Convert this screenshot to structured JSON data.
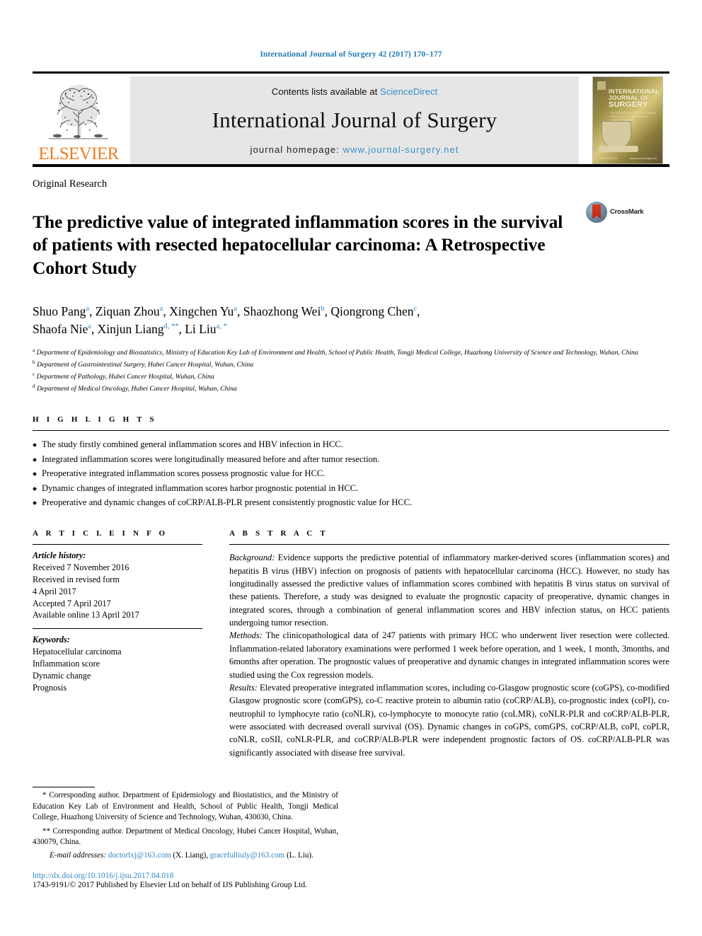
{
  "running_head": "International Journal of Surgery 42 (2017) 170–177",
  "masthead": {
    "publisher_name": "ELSEVIER",
    "contents_prefix": "Contents lists available at ",
    "sciencedirect": "ScienceDirect",
    "journal_name": "International Journal of Surgery",
    "homepage_prefix": "journal homepage: ",
    "homepage_url": "www.journal-surgery.net",
    "cover": {
      "line1": "INTERNATIONAL",
      "line2": "JOURNAL OF",
      "line3": "SURGERY",
      "subtitle": "The Official Journal of the Surgical Associates Ltd. International Journal of Surgery",
      "footer_left": "ISSN 1743-9191",
      "footer_right": "www.journal-surgery.net"
    }
  },
  "article": {
    "section_label": "Original Research",
    "title": "The predictive value of integrated inflammation scores in the survival of patients with resected hepatocellular carcinoma: A Retrospective Cohort Study",
    "crossmark_label": "CrossMark",
    "authors_line1": "Shuo Pang ᵃ, Ziquan Zhou ᵃ, Xingchen Yu ᵃ, Shaozhong Wei ᵇ, Qiongrong Chen ᶜ,",
    "authors_line2": "Shaofa Nie ᵃ, Xinjun Liang ᵈ,**, Li Liu ᵃ,*",
    "authors": [
      {
        "name": "Shuo Pang",
        "sup": "a"
      },
      {
        "name": "Ziquan Zhou",
        "sup": "a"
      },
      {
        "name": "Xingchen Yu",
        "sup": "a"
      },
      {
        "name": "Shaozhong Wei",
        "sup": "b"
      },
      {
        "name": "Qiongrong Chen",
        "sup": "c"
      },
      {
        "name": "Shaofa Nie",
        "sup": "a"
      },
      {
        "name": "Xinjun Liang",
        "sup": "d, **"
      },
      {
        "name": "Li Liu",
        "sup": "a, *"
      }
    ],
    "affiliations": [
      {
        "marker": "a",
        "text": "Department of Epidemiology and Biostatistics, Ministry of Education Key Lab of Environment and Health, School of Public Health, Tongji Medical College, Huazhong University of Science and Technology, Wuhan, China"
      },
      {
        "marker": "b",
        "text": "Department of Gastrointestinal Surgery, Hubei Cancer Hospital, Wuhan, China"
      },
      {
        "marker": "c",
        "text": "Department of Pathology, Hubei Cancer Hospital, Wuhan, China"
      },
      {
        "marker": "d",
        "text": "Department of Medical Oncology, Hubei Cancer Hospital, Wuhan, China"
      }
    ]
  },
  "highlights": {
    "heading": "H I G H L I G H T S",
    "items": [
      "The study firstly combined general inflammation scores and HBV infection in HCC.",
      "Integrated inflammation scores were longitudinally measured before and after tumor resection.",
      "Preoperative integrated inflammation scores possess prognostic value for HCC.",
      "Dynamic changes of integrated inflammation scores harbor prognostic potential in HCC.",
      "Preoperative and dynamic changes of coCRP/ALB-PLR present consistently prognostic value for HCC."
    ]
  },
  "article_info": {
    "heading": "A R T I C L E   I N F O",
    "history_label": "Article history:",
    "history": [
      "Received 7 November 2016",
      "Received in revised form",
      "4 April 2017",
      "Accepted 7 April 2017",
      "Available online 13 April 2017"
    ],
    "keywords_label": "Keywords:",
    "keywords": [
      "Hepatocellular carcinoma",
      "Inflammation score",
      "Dynamic change",
      "Prognosis"
    ]
  },
  "abstract": {
    "heading": "A B S T R A C T",
    "paragraphs": [
      {
        "label": "Background:",
        "text": " Evidence supports the predictive potential of inflammatory marker-derived scores (inflammation scores) and hepatitis B virus (HBV) infection on prognosis of patients with hepatocellular carcinoma (HCC). However, no study has longitudinally assessed the predictive values of inflammation scores combined with hepatitis B virus status on survival of these patients. Therefore, a study was designed to evaluate the prognostic capacity of preoperative, dynamic changes in integrated scores, through a combination of general inflammation scores and HBV infection status, on HCC patients undergoing tumor resection."
      },
      {
        "label": "Methods:",
        "text": " The clinicopathological data of 247 patients with primary HCC who underwent liver resection were collected. Inflammation-related laboratory examinations were performed 1 week before operation, and 1 week, 1 month, 3months, and 6months after operation. The prognostic values of preoperative and dynamic changes in integrated inflammation scores were studied using the Cox regression models."
      },
      {
        "label": "Results:",
        "text": " Elevated preoperative integrated inflammation scores, including co-Glasgow prognostic score (coGPS), co-modified Glasgow prognostic score (comGPS), co-C reactive protein to albumin ratio (coCRP/ALB), co-prognostic index (coPI), co-neutrophil to lymphocyte ratio (coNLR), co-lymphocyte to monocyte ratio (coLMR), coNLR-PLR and coCRP/ALB-PLR, were associated with decreased overall survival (OS). Dynamic changes in coGPS, comGPS, coCRP/ALB, coPI, coPLR, coNLR, coSII, coNLR-PLR, and coCRP/ALB-PLR were independent prognostic factors of OS. coCRP/ALB-PLR was significantly associated with disease free survival."
      }
    ]
  },
  "footer": {
    "corr1": "Corresponding author. Department of Epidemiology and Biostatistics, and the Ministry of Education Key Lab of Environment and Health, School of Public Health, Tongji Medical College, Huazhong University of Science and Technology, Wuhan, 430030, China.",
    "corr1_marker": "*",
    "corr2": "Corresponding author. Department of Medical Oncology, Hubei Cancer Hospital, Wuhan, 430079, China.",
    "corr2_marker": "**",
    "email_label": "E-mail addresses:",
    "email1": "doctorlxj@163.com",
    "email1_owner": "(X. Liang),",
    "email2": "gracefulliuly@163.com",
    "email2_owner": "(L. Liu).",
    "doi": "http://dx.doi.org/10.1016/j.ijsu.2017.04.018",
    "copyright": "1743-9191/© 2017 Published by Elsevier Ltd on behalf of IJS Publishing Group Ltd."
  },
  "colors": {
    "link": "#2f86c5",
    "elsevier_orange": "#ef7d22",
    "band_gray": "#e6e6e6",
    "crossmark_red": "#c8301a"
  }
}
